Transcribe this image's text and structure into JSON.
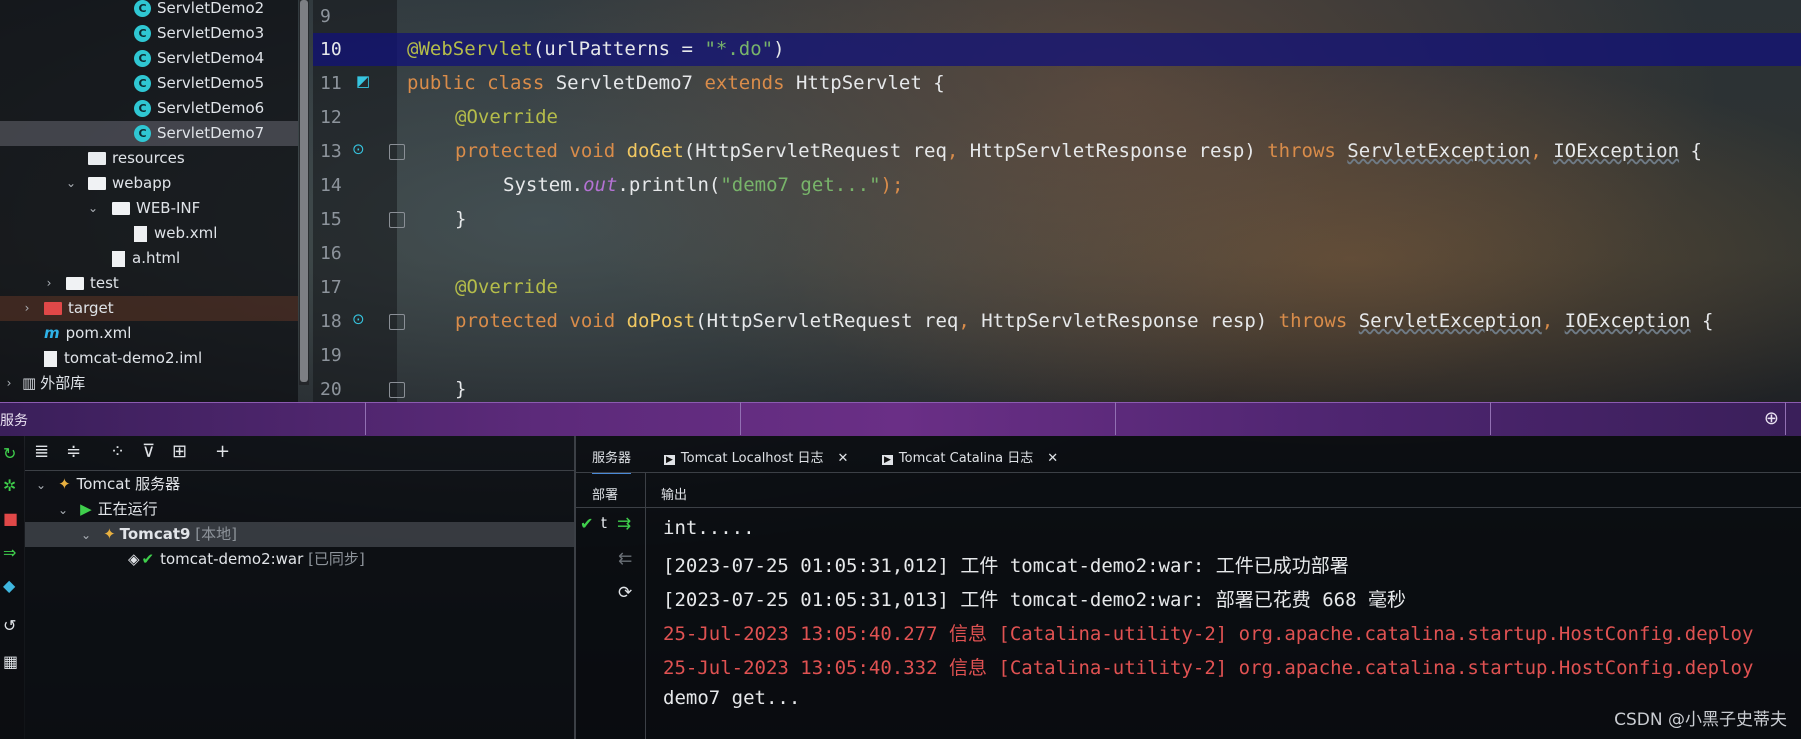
{
  "project_tree": {
    "items": [
      {
        "label": "ServletDemo2"
      },
      {
        "label": "ServletDemo3"
      },
      {
        "label": "ServletDemo4"
      },
      {
        "label": "ServletDemo5"
      },
      {
        "label": "ServletDemo6"
      },
      {
        "label": "ServletDemo7"
      },
      {
        "label": "resources"
      },
      {
        "label": "webapp"
      },
      {
        "label": "WEB-INF"
      },
      {
        "label": "web.xml"
      },
      {
        "label": "a.html"
      },
      {
        "label": "test"
      },
      {
        "label": "target"
      },
      {
        "label": "pom.xml"
      },
      {
        "label": "tomcat-demo2.iml"
      },
      {
        "label": "外部库"
      }
    ],
    "class_icon_letter": "C"
  },
  "editor": {
    "line_numbers": [
      "9",
      "10",
      "11",
      "12",
      "13",
      "14",
      "15",
      "16",
      "17",
      "18",
      "19",
      "20"
    ],
    "lines": {
      "l10_ann": "@WebServlet",
      "l10_a": "(urlPatterns = ",
      "l10_str": "\"*.do\"",
      "l10_b": ")",
      "l11_kw1": "public class ",
      "l11_a": "ServletDemo7 ",
      "l11_kw2": "extends ",
      "l11_b": "HttpServlet {",
      "l12": "@Override",
      "l13_kw": "protected void ",
      "l13_fn": "doGet",
      "l13_a": "(HttpServletRequest req",
      "l13_c": ", ",
      "l13_b": "HttpServletResponse resp) ",
      "l13_kw2": "throws ",
      "l13_e1": "ServletException",
      "l13_c2": ", ",
      "l13_e2": "IOException",
      "l13_end": " {",
      "l14_a": "System.",
      "l14_fld": "out",
      "l14_b": ".println(",
      "l14_str": "\"demo7 get...\"",
      "l14_c": ");",
      "l15": "}",
      "l17": "@Override",
      "l18_kw": "protected void ",
      "l18_fn": "doPost",
      "l18_a": "(HttpServletRequest req",
      "l18_c": ", ",
      "l18_b": "HttpServletResponse resp) ",
      "l18_kw2": "throws ",
      "l18_e1": "ServletException",
      "l18_c2": ", ",
      "l18_e2": "IOException",
      "l18_end": " {",
      "l20": "}"
    }
  },
  "services_bar": {
    "title": "服务"
  },
  "services_tree": {
    "root": "Tomcat 服务器",
    "running": "正在运行",
    "server": "Tomcat9",
    "server_tag": "[本地]",
    "artifact": "tomcat-demo2:war",
    "artifact_tag": "[已同步]"
  },
  "tabs": [
    {
      "label": "服务器"
    },
    {
      "label": "Tomcat Localhost 日志"
    },
    {
      "label": "Tomcat Catalina 日志"
    }
  ],
  "columns": {
    "deploy": "部署",
    "output": "输出"
  },
  "deploy_marker": "t",
  "output_lines": [
    {
      "text": "int....."
    },
    {
      "text": "[2023-07-25 01:05:31,012] 工件 tomcat-demo2:war: 工件已成功部署"
    },
    {
      "text": "[2023-07-25 01:05:31,013] 工件 tomcat-demo2:war: 部署已花费 668 毫秒"
    },
    {
      "text": "25-Jul-2023 13:05:40.277 信息 [Catalina-utility-2] org.apache.catalina.startup.HostConfig.deploy"
    },
    {
      "text": "25-Jul-2023 13:05:40.332 信息 [Catalina-utility-2] org.apache.catalina.startup.HostConfig.deploy"
    },
    {
      "text": "demo7 get..."
    }
  ],
  "watermark": "CSDN @小黑子史蒂夫",
  "colors": {
    "accent": "#4a8ad8",
    "error_text": "#e05252",
    "run_green": "#3fcf4c",
    "services_bar": "#5c2a7a"
  }
}
